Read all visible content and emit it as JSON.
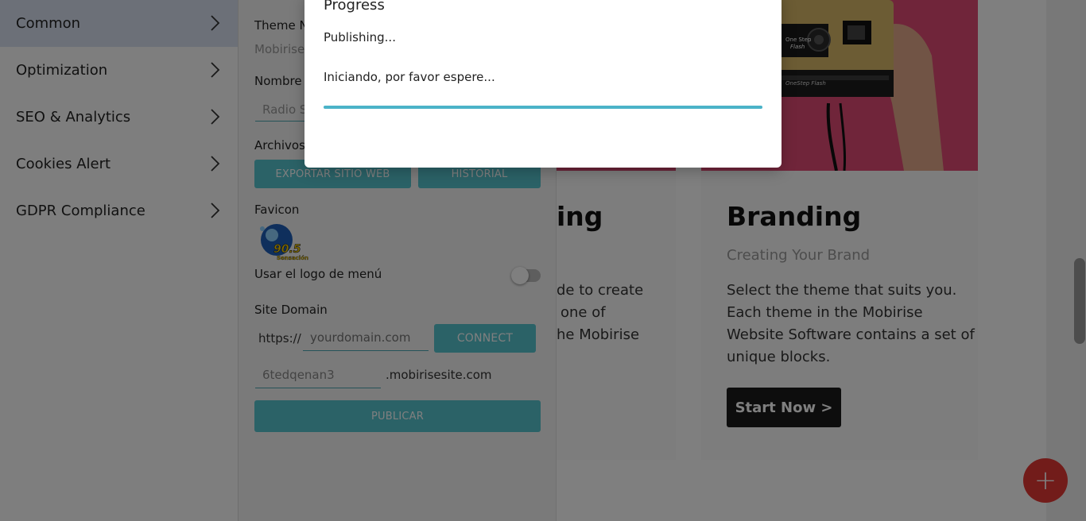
{
  "sidebar": {
    "items": [
      {
        "label": "Common"
      },
      {
        "label": "Optimization"
      },
      {
        "label": "SEO & Analytics"
      },
      {
        "label": "Cookies Alert"
      },
      {
        "label": "GDPR Compliance"
      }
    ]
  },
  "panel": {
    "theme_name_label": "Theme Na",
    "theme_name_value": "Mobirise",
    "site_name_label": "Nombre d",
    "site_name_value": "Radio S",
    "files_label": "Archivos",
    "export_button": "EXPORTAR SITIO WEB",
    "history_button": "HISTORIAL",
    "favicon_label": "Favicon",
    "favicon_logo": {
      "number": "90.5",
      "text": "Sensación"
    },
    "menu_logo_toggle_label": "Usar el logo de menú",
    "menu_logo_toggle_on": false,
    "site_domain_label": "Site Domain",
    "domain_prefix": "https://",
    "domain_placeholder": "yourdomain.com",
    "connect_button": "CONNECT",
    "subdomain_value": "6tedqenan3",
    "subdomain_suffix": ".mobirisesite.com",
    "publish_button": "PUBLICAR"
  },
  "preview": {
    "left_card": {
      "title_fragment": "ing",
      "text_lines": [
        "de to create",
        "one of",
        "he Mobirise"
      ]
    },
    "right_card": {
      "title": "Branding",
      "subtitle": "Creating Your Brand",
      "text_lines": [
        "Select the theme that suits you.",
        "Each theme in the Mobirise",
        "Website Software contains a set of",
        "unique blocks."
      ],
      "button": "Start Now >",
      "camera_text": [
        "One Step",
        "Flash",
        "OneStep Flash"
      ]
    },
    "fab_icon": "plus-icon",
    "fab_glyph": "+"
  },
  "dialog": {
    "title": "Progress",
    "status": "Publishing...",
    "message": "Iniciando, por favor espere...",
    "progress": 1.0
  },
  "colors": {
    "accent_teal": "#57c4cf",
    "progress_blue": "#4bb3c8",
    "sidebar_active": "#d8e1f0",
    "fab_red": "#e53935"
  }
}
